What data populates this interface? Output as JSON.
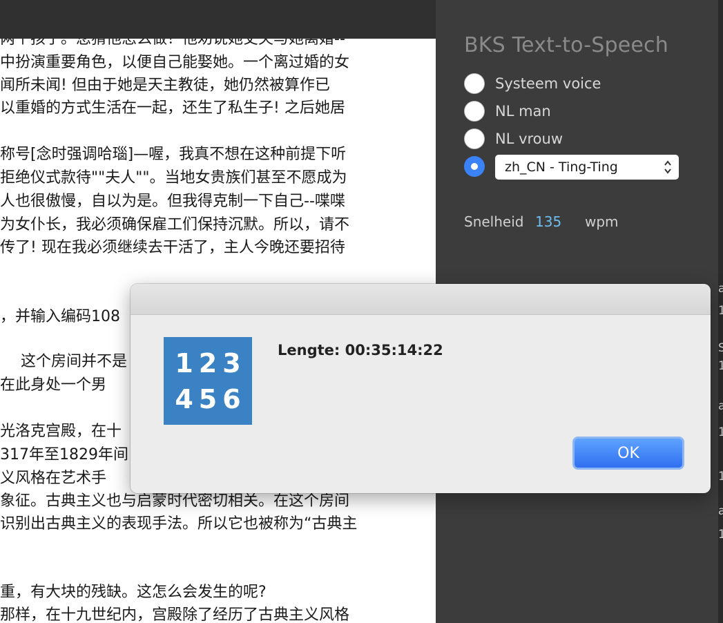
{
  "document": {
    "lines": [
      "两个孩子。您猜他怎么做？他劝说她丈夫与她离婚--",
      "中扮演重要角色，以便自己能娶她。一个离过婚的女",
      "闻所未闻! 但由于她是天主教徒，她仍然被算作已",
      "以重婚的方式生活在一起，还生了私生子! 之后她居",
      "称号[念时强调哈瑙]—喔，我真不想在这种前提下听",
      "拒绝仪式款待\"\"夫人\"\"。当地女贵族们甚至不愿成为",
      "人也很傲慢，自以为是。但我得克制一下自己--喋喋",
      "为女仆长，我必须确保雇工们保持沉默。所以，请不",
      "传了! 现在我必须继续去干活了，主人今晚还要招待",
      "，并输入编码108",
      "这个房间并不是",
      "在此身处一个男",
      "光洛克宫殿，在十",
      "317年至1829年间",
      "义风格在艺术手",
      "象征。古典主义也与启蒙时代密切相关。在这个房间",
      "识别出古典主义的表现手法。所以它也被称为“古典主",
      "重，有大块的残缺。这怎么会发生的呢?",
      "那样，在十九世纪内，宫殿除了经历了古典主义风格"
    ]
  },
  "panel": {
    "title": "BKS Text-to-Speech",
    "voices": [
      {
        "label": "Systeem voice",
        "selected": false
      },
      {
        "label": "NL man",
        "selected": false
      },
      {
        "label": "NL vrouw",
        "selected": false
      }
    ],
    "custom_voice_selected": true,
    "voice_select_value": "zh_CN  -  Ting-Ting",
    "speed_label": "Snelheid",
    "speed_value": "135",
    "speed_unit": "wpm",
    "edge_fragments": [
      "a",
      "1",
      "S",
      "1",
      "a",
      "1",
      "1",
      "a",
      "1"
    ]
  },
  "dialog": {
    "icon_row1": "123",
    "icon_row2": "456",
    "message": "Lengte: 00:35:14:22",
    "ok_label": "OK"
  },
  "colors": {
    "accent_blue": "#3b82f6",
    "icon_blue": "#3b82c4",
    "speed_value": "#6fbef0",
    "panel_bg": "#3c3c3c",
    "dialog_bg": "#ececec"
  }
}
